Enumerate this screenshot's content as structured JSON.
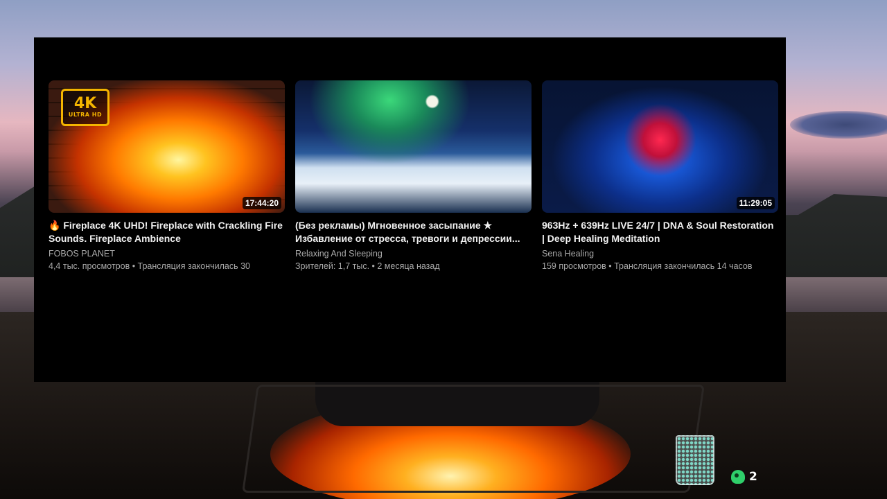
{
  "videos": [
    {
      "duration": "17:44:20",
      "badge_main": "4K",
      "badge_sub": "ULTRA HD",
      "title": "🔥 Fireplace 4K UHD! Fireplace with Crackling Fire Sounds. Fireplace Ambience",
      "channel": "FOBOS PLANET",
      "meta": "4,4 тыс. просмотров • Трансляция закончилась 30"
    },
    {
      "duration": "",
      "title": "(Без рекламы) Мгновенное засыпание ★ Избавление от стресса, тревоги и депрессии...",
      "channel": "Relaxing And Sleeping",
      "meta": "Зрителей: 1,7 тыс. • 2 месяца назад"
    },
    {
      "duration": "11:29:05",
      "title": "963Hz + 639Hz LIVE 24/7 | DNA & Soul Restoration | Deep Healing Meditation",
      "channel": "Sena Healing",
      "meta": "159 просмотров • Трансляция закончилась 14 часов"
    }
  ],
  "widgets": {
    "jar_icon": "glass-jar-icon",
    "counter_icon": "green-token-icon",
    "counter_value": "2"
  }
}
